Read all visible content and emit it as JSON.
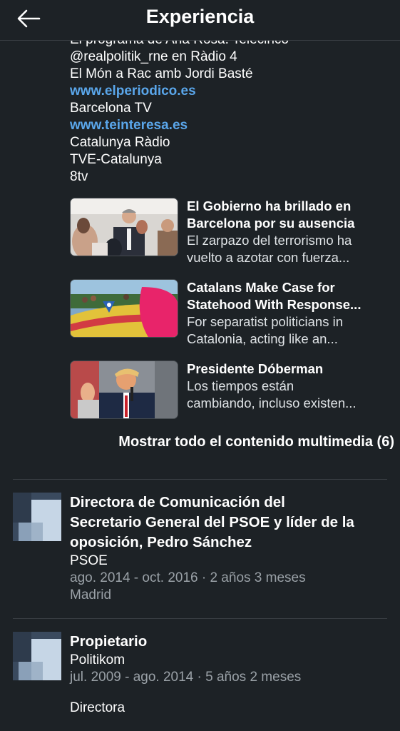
{
  "header": {
    "title": "Experiencia",
    "back_icon": "arrow-left-icon"
  },
  "links": [
    {
      "text": "El programa de Ana Rosa. Telecinco",
      "is_link": false
    },
    {
      "text": "@realpolitik_rne en Ràdio 4",
      "is_link": false
    },
    {
      "text": "El Món a Rac amb Jordi Basté",
      "is_link": false
    },
    {
      "text": "www.elperiodico.es",
      "is_link": true
    },
    {
      "text": "Barcelona TV",
      "is_link": false
    },
    {
      "text": "www.teinteresa.es",
      "is_link": true
    },
    {
      "text": "Catalunya Ràdio",
      "is_link": false
    },
    {
      "text": "TVE-Catalunya",
      "is_link": false
    },
    {
      "text": "8tv",
      "is_link": false
    }
  ],
  "media": [
    {
      "title": "El Gobierno ha brillado en",
      "title2": "Barcelona por su ausencia",
      "desc1": "El zarpazo del terrorismo ha",
      "desc2": "vuelto a azotar con fuerza..."
    },
    {
      "title": "Catalans Make Case for",
      "title2": "Statehood With Response...",
      "desc1": "For separatist politicians in",
      "desc2": "Catalonia, acting like an..."
    },
    {
      "title": "Presidente Dóberman",
      "title2": "",
      "desc1": "Los tiempos están",
      "desc2": "cambiando, incluso existen..."
    }
  ],
  "show_all_label": "Mostrar todo el contenido multimedia (6)",
  "positions": [
    {
      "title_lines": [
        "Directora de Comunicación del",
        "Secretario General del PSOE y líder de la",
        "oposición, Pedro Sánchez"
      ],
      "company": "PSOE",
      "dates": "ago. 2014 - oct. 2016 · 2 años 3 meses",
      "location": "Madrid"
    },
    {
      "title_lines": [
        "Propietario"
      ],
      "company": "Politikom",
      "dates": "jul. 2009 - ago. 2014 · 5 años 2 meses",
      "description": "Directora"
    }
  ],
  "colors": {
    "background": "#1d2226",
    "link": "#5aa6ea",
    "muted": "#9aa1a7"
  }
}
